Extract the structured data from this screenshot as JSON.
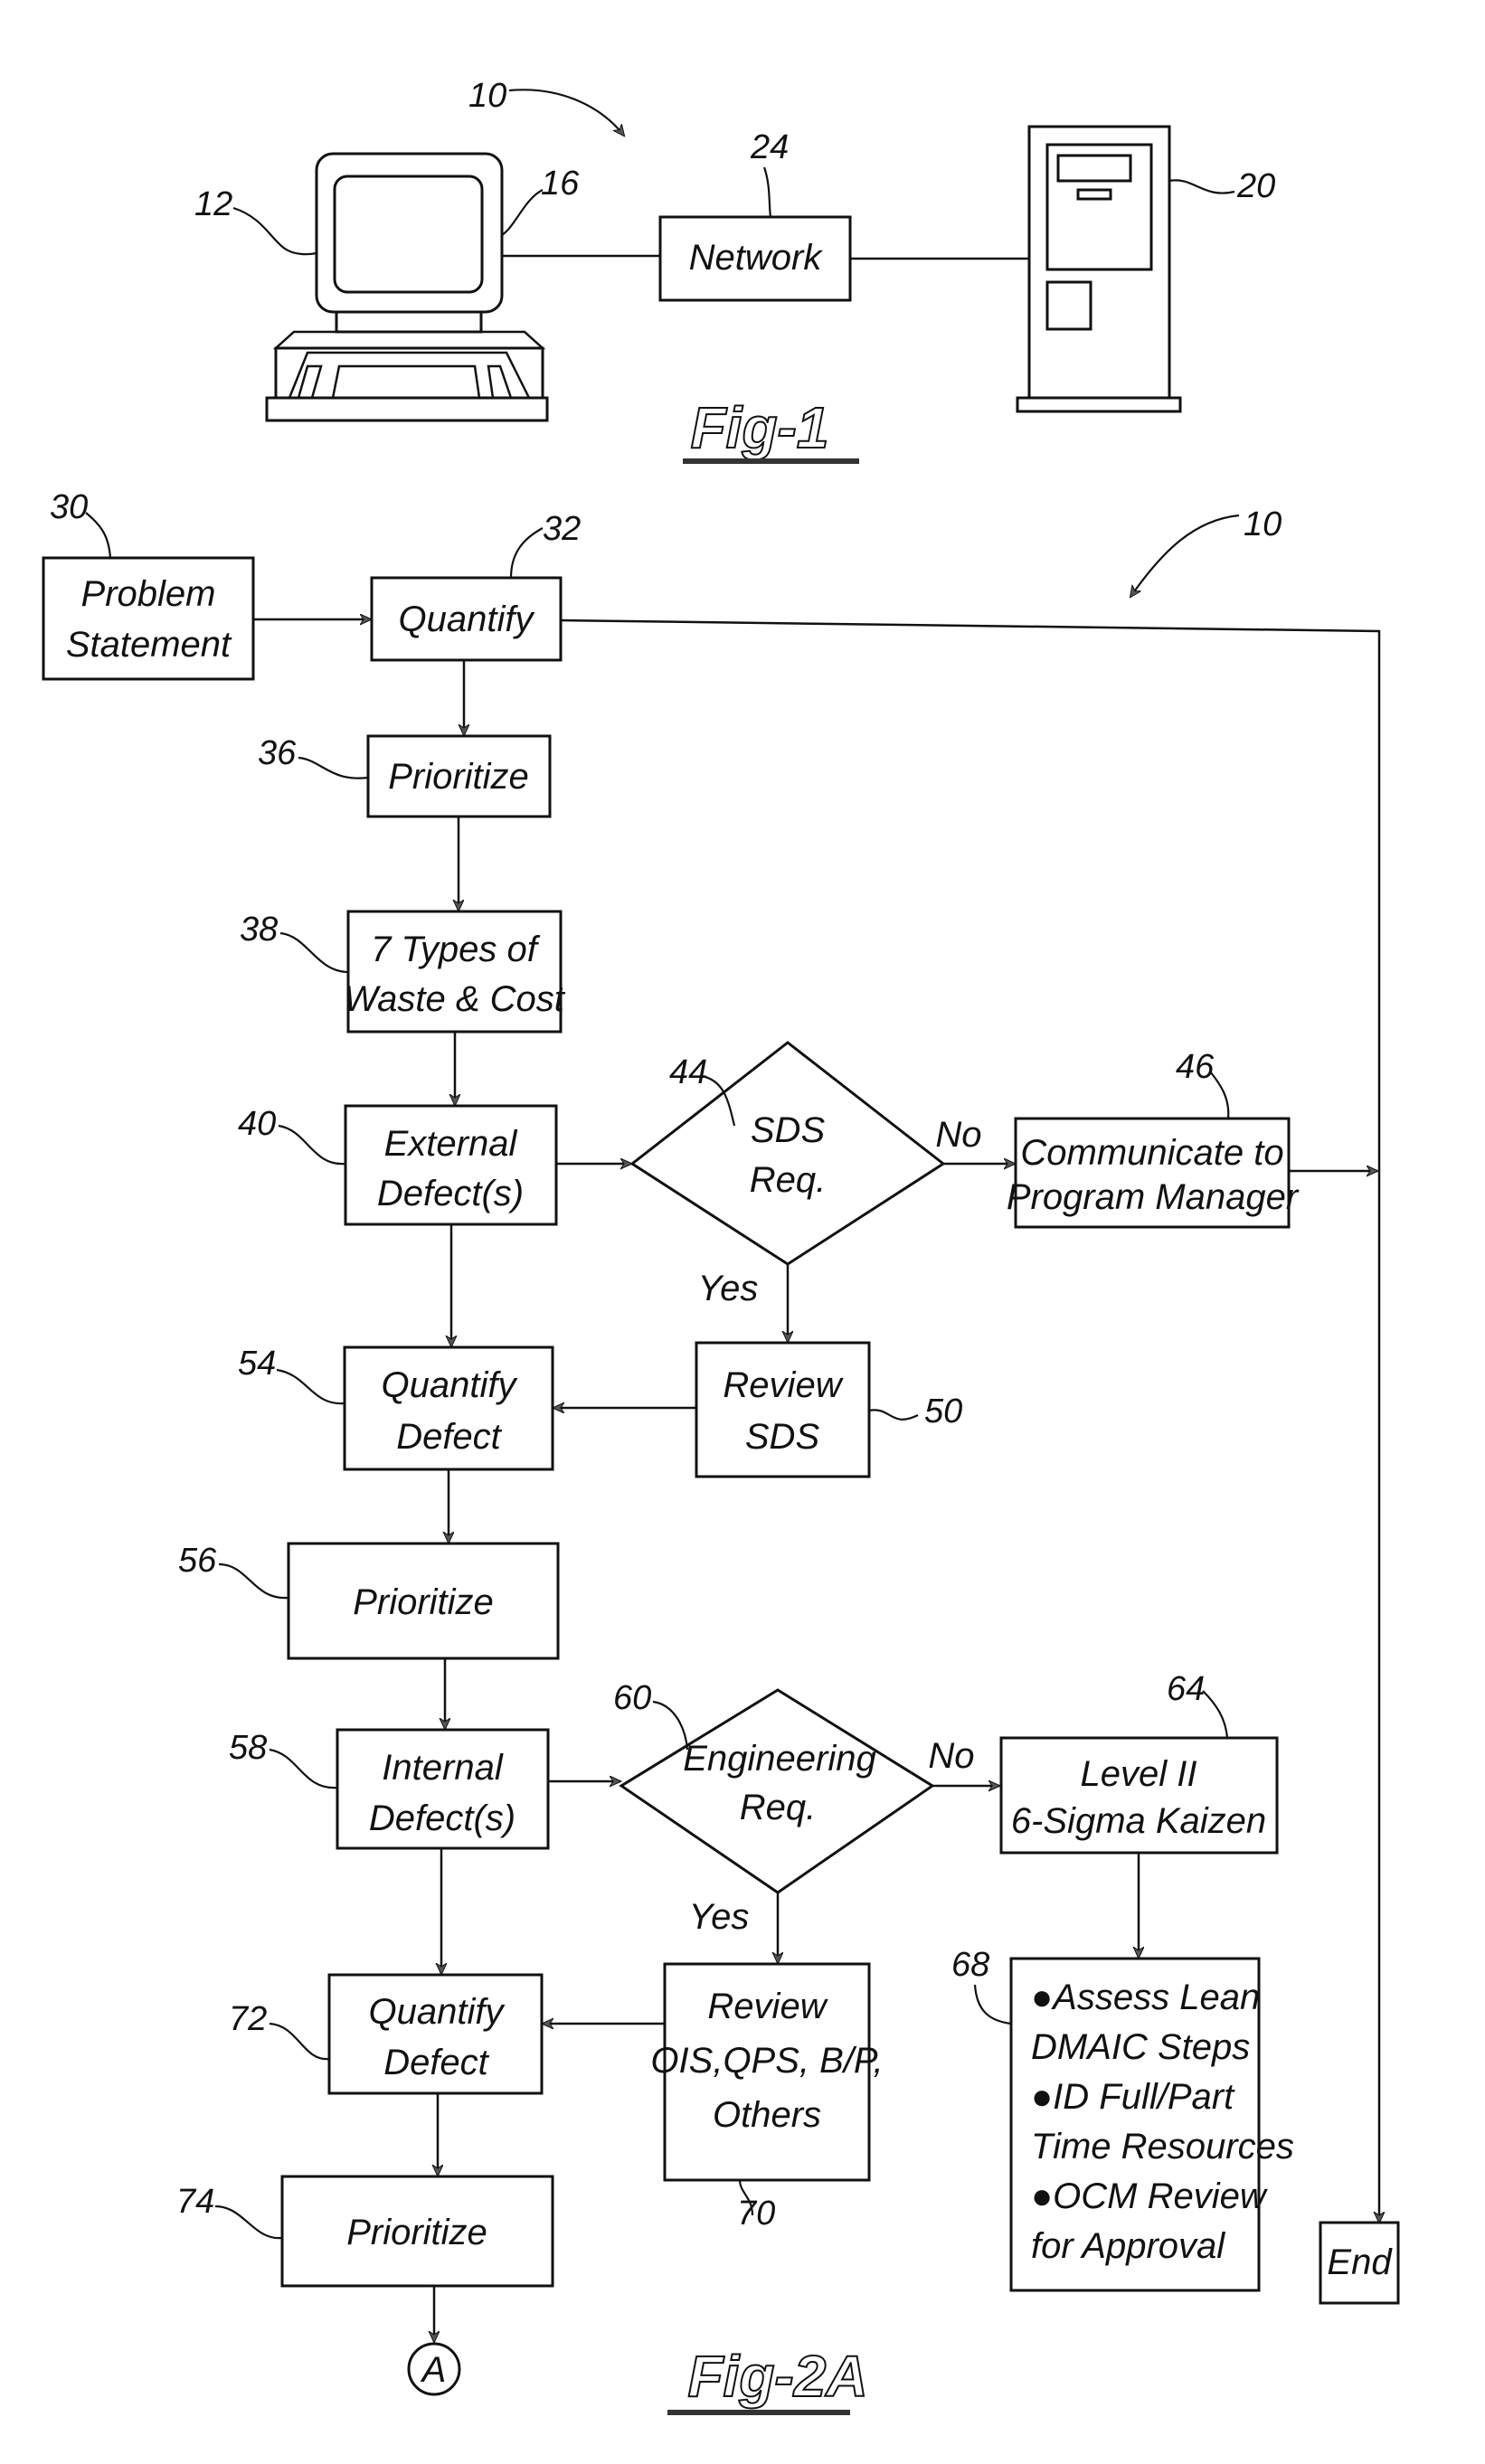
{
  "fig1": {
    "title": "Fig-1",
    "system_ref": "10",
    "computer_ref": "12",
    "display_ref": "16",
    "network": {
      "label": "Network",
      "ref": "24"
    },
    "server_ref": "20"
  },
  "fig2a": {
    "title": "Fig-2A",
    "system_ref": "10",
    "nodes": {
      "problem_statement": {
        "lines": [
          "Problem",
          "Statement"
        ],
        "ref": "30"
      },
      "quantify": {
        "lines": [
          "Quantify"
        ],
        "ref": "32"
      },
      "prioritize_1": {
        "lines": [
          "Prioritize"
        ],
        "ref": "36"
      },
      "waste_cost": {
        "lines": [
          "7 Types of",
          "Waste & Cost"
        ],
        "ref": "38"
      },
      "external_defects": {
        "lines": [
          "External",
          "Defect(s)"
        ],
        "ref": "40"
      },
      "sds_req": {
        "lines": [
          "SDS",
          "Req."
        ],
        "ref": "44"
      },
      "communicate": {
        "lines": [
          "Communicate to",
          "Program Manager"
        ],
        "ref": "46"
      },
      "review_sds": {
        "lines": [
          "Review",
          "SDS"
        ],
        "ref": "50"
      },
      "quantify_defect_1": {
        "lines": [
          "Quantify",
          "Defect"
        ],
        "ref": "54"
      },
      "prioritize_2": {
        "lines": [
          "Prioritize"
        ],
        "ref": "56"
      },
      "internal_defects": {
        "lines": [
          "Internal",
          "Defect(s)"
        ],
        "ref": "58"
      },
      "engineering_req": {
        "lines": [
          "Engineering",
          "Req."
        ],
        "ref": "60"
      },
      "level_ii": {
        "lines": [
          "Level II",
          "6-Sigma Kaizen"
        ],
        "ref": "64"
      },
      "assess_box": {
        "lines": [
          "●Assess Lean",
          "DMAIC Steps",
          "●ID Full/Part",
          "Time Resources",
          "●OCM Review",
          "for Approval"
        ],
        "ref": "68"
      },
      "review_ois": {
        "lines": [
          "Review",
          "OIS,QPS, B/P,",
          "Others"
        ],
        "ref": "70"
      },
      "quantify_defect_2": {
        "lines": [
          "Quantify",
          "Defect"
        ],
        "ref": "72"
      },
      "prioritize_3": {
        "lines": [
          "Prioritize"
        ],
        "ref": "74"
      },
      "end": {
        "lines": [
          "End"
        ]
      },
      "connector": {
        "lines": [
          "A"
        ]
      }
    },
    "edge_labels": {
      "sds_no": "No",
      "sds_yes": "Yes",
      "eng_no": "No",
      "eng_yes": "Yes"
    }
  }
}
